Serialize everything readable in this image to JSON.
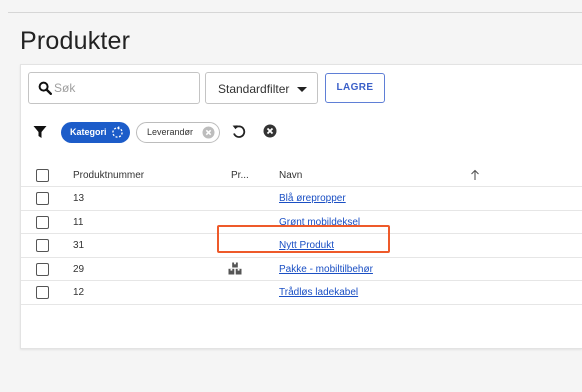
{
  "page": {
    "title": "Produkter"
  },
  "toolbar": {
    "search_placeholder": "Søk",
    "filter_select_label": "Standardfilter",
    "save_label": "LAGRE"
  },
  "chips": [
    {
      "label": "Kategori",
      "active": true
    },
    {
      "label": "Leverandør",
      "active": false
    }
  ],
  "table": {
    "headers": {
      "number": "Produktnummer",
      "pr": "Pr...",
      "name": "Navn"
    },
    "rows": [
      {
        "number": "13",
        "name": "Blå ørepropper",
        "has_package_icon": false
      },
      {
        "number": "11",
        "name": "Grønt mobildeksel",
        "has_package_icon": false
      },
      {
        "number": "31",
        "name": "Nytt Produkt",
        "has_package_icon": false
      },
      {
        "number": "29",
        "name": "Pakke - mobiltilbehør",
        "has_package_icon": true
      },
      {
        "number": "12",
        "name": "Trådløs ladekabel",
        "has_package_icon": false
      }
    ]
  },
  "colors": {
    "accent": "#1c5cc9",
    "highlight": "#ee5a2a",
    "link": "#1a4fc4"
  }
}
